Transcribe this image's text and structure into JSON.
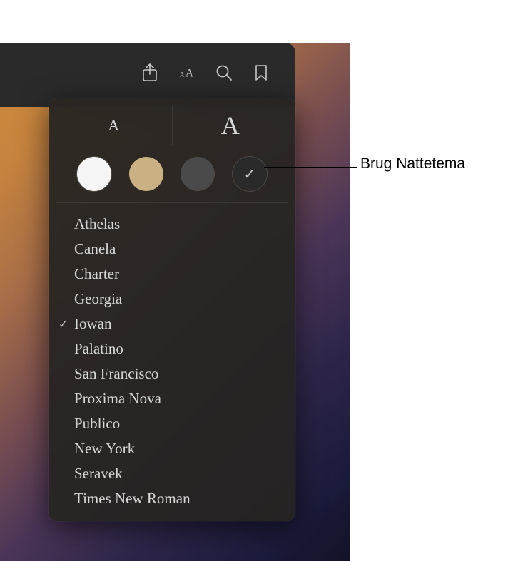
{
  "toolbar": {
    "icons": [
      "share-icon",
      "appearance-icon",
      "search-icon",
      "bookmark-icon"
    ]
  },
  "popover": {
    "font_size": {
      "small_label": "A",
      "large_label": "A"
    },
    "themes": [
      {
        "name": "white",
        "selected": false
      },
      {
        "name": "sepia",
        "selected": false
      },
      {
        "name": "gray",
        "selected": false
      },
      {
        "name": "night",
        "selected": true
      }
    ],
    "fonts": [
      {
        "label": "Athelas",
        "selected": false
      },
      {
        "label": "Canela",
        "selected": false
      },
      {
        "label": "Charter",
        "selected": false
      },
      {
        "label": "Georgia",
        "selected": false
      },
      {
        "label": "Iowan",
        "selected": true
      },
      {
        "label": "Palatino",
        "selected": false
      },
      {
        "label": "San Francisco",
        "selected": false
      },
      {
        "label": "Proxima Nova",
        "selected": false
      },
      {
        "label": "Publico",
        "selected": false
      },
      {
        "label": "New York",
        "selected": false
      },
      {
        "label": "Seravek",
        "selected": false
      },
      {
        "label": "Times New Roman",
        "selected": false
      }
    ]
  },
  "callout": {
    "label": "Brug Nattetema"
  }
}
